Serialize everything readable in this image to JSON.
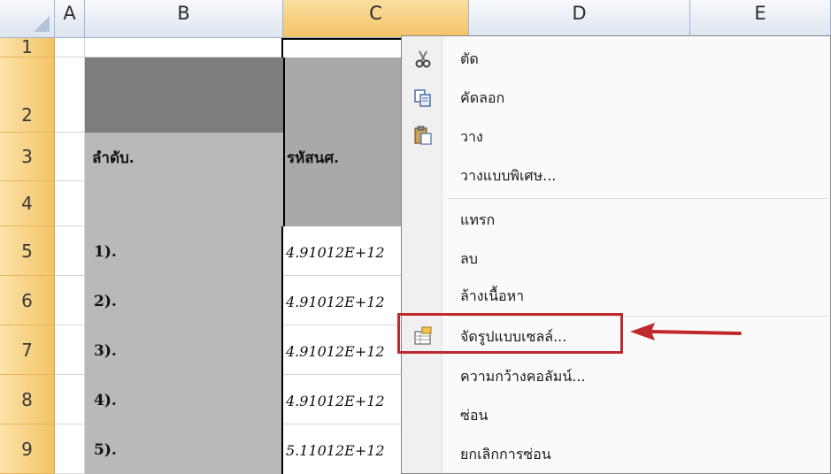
{
  "columns": [
    "A",
    "B",
    "C",
    "D",
    "E"
  ],
  "rows": [
    "1",
    "2",
    "3",
    "4",
    "5",
    "6",
    "7",
    "8",
    "9"
  ],
  "cells": {
    "b3": "ลำดับ.",
    "c3": "รหัสนศ.",
    "b_rows": [
      "1).",
      "2).",
      "3).",
      "4).",
      "5)."
    ],
    "c_rows": [
      "4.91012E+12",
      "4.91012E+12",
      "4.91012E+12",
      "4.91012E+12",
      "5.11012E+12"
    ]
  },
  "menu": {
    "items": [
      {
        "label": "ตัด",
        "icon": "scissors-icon"
      },
      {
        "label": "คัดลอก",
        "icon": "copy-icon"
      },
      {
        "label": "วาง",
        "icon": "paste-icon"
      },
      {
        "label": "วางแบบพิเศษ..."
      },
      {
        "label": "แทรก"
      },
      {
        "label": "ลบ"
      },
      {
        "label": "ล้างเนื้อหา"
      },
      {
        "label": "จัดรูปแบบเซลล์...",
        "icon": "format-cells-icon",
        "highlighted": true
      },
      {
        "label": "ความกว้างคอลัมน์..."
      },
      {
        "label": "ซ่อน"
      },
      {
        "label": "ยกเลิกการซ่อน"
      }
    ]
  },
  "colors": {
    "annotation": "#c0282e",
    "row_header": "#f3c465",
    "col_header": "#dde5f0"
  }
}
